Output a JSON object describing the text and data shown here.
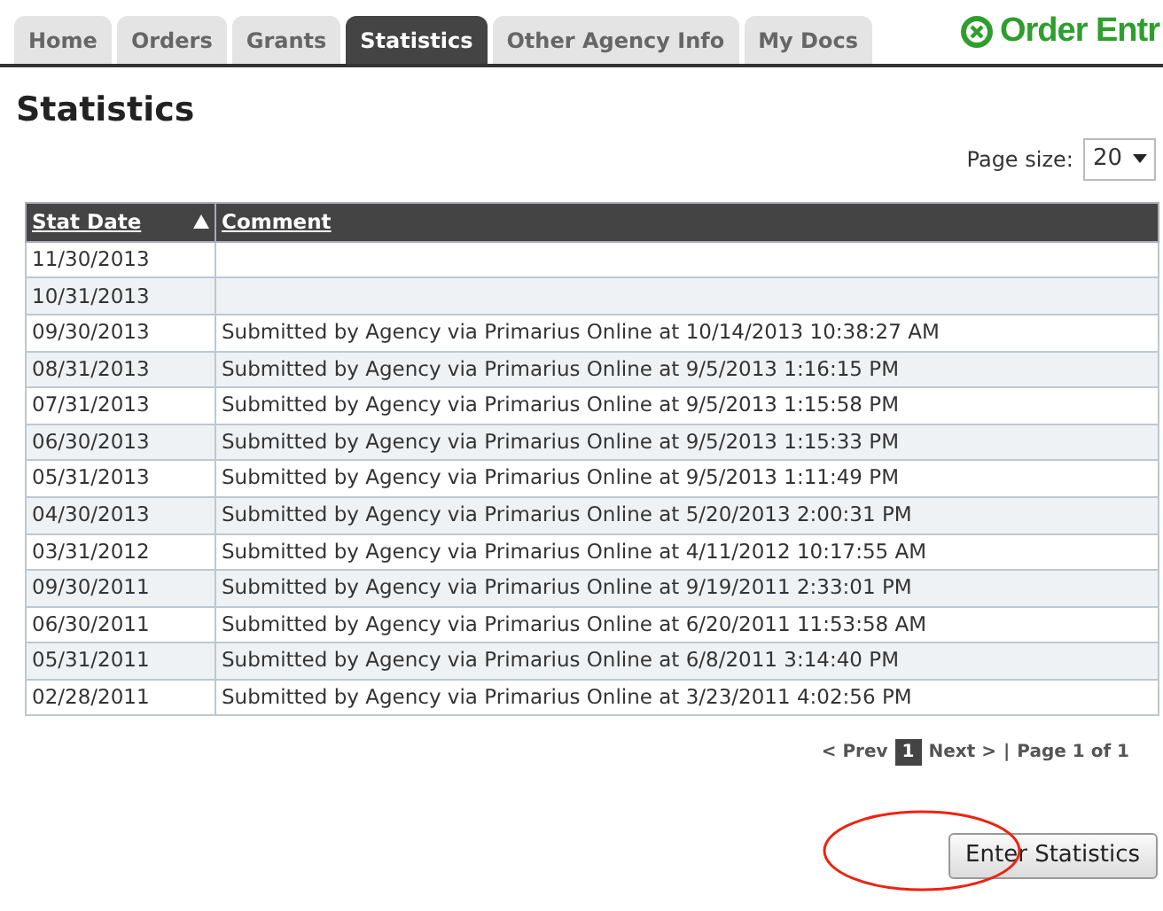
{
  "tabs": [
    {
      "label": "Home",
      "selected": false
    },
    {
      "label": "Orders",
      "selected": false
    },
    {
      "label": "Grants",
      "selected": false
    },
    {
      "label": "Statistics",
      "selected": true
    },
    {
      "label": "Other Agency Info",
      "selected": false
    },
    {
      "label": "My Docs",
      "selected": false
    }
  ],
  "app_title": "Order Entr",
  "heading": "Statistics",
  "page_size": {
    "label": "Page size:",
    "value": "20"
  },
  "table": {
    "columns": [
      {
        "label": "Stat Date",
        "sorted": true
      },
      {
        "label": "Comment",
        "sorted": false
      }
    ],
    "rows": [
      [
        "11/30/2013",
        ""
      ],
      [
        "10/31/2013",
        ""
      ],
      [
        "09/30/2013",
        "Submitted by Agency via Primarius Online at 10/14/2013 10:38:27 AM"
      ],
      [
        "08/31/2013",
        "Submitted by Agency via Primarius Online at 9/5/2013 1:16:15 PM"
      ],
      [
        "07/31/2013",
        "Submitted by Agency via Primarius Online at 9/5/2013 1:15:58 PM"
      ],
      [
        "06/30/2013",
        "Submitted by Agency via Primarius Online at 9/5/2013 1:15:33 PM"
      ],
      [
        "05/31/2013",
        "Submitted by Agency via Primarius Online at 9/5/2013 1:11:49 PM"
      ],
      [
        "04/30/2013",
        "Submitted by Agency via Primarius Online at 5/20/2013 2:00:31 PM"
      ],
      [
        "03/31/2012",
        "Submitted by Agency via Primarius Online at 4/11/2012 10:17:55 AM"
      ],
      [
        "09/30/2011",
        "Submitted by Agency via Primarius Online at 9/19/2011 2:33:01 PM"
      ],
      [
        "06/30/2011",
        "Submitted by Agency via Primarius Online at 6/20/2011 11:53:58 AM"
      ],
      [
        "05/31/2011",
        "Submitted by Agency via Primarius Online at 6/8/2011 3:14:40 PM"
      ],
      [
        "02/28/2011",
        "Submitted by Agency via Primarius Online at 3/23/2011 4:02:56 PM"
      ]
    ]
  },
  "pager": {
    "prev": "< Prev",
    "pages": [
      {
        "label": "1",
        "selected": true
      }
    ],
    "next": "Next >",
    "separator": "|",
    "summary": "Page 1 of 1"
  },
  "button": "Enter Statistics"
}
